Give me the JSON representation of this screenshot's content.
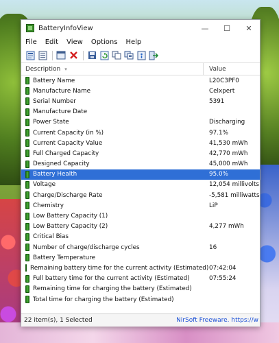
{
  "window": {
    "title": "BatteryInfoView",
    "minimize": "—",
    "maximize": "☐",
    "close": "✕"
  },
  "menu": [
    "File",
    "Edit",
    "View",
    "Options",
    "Help"
  ],
  "toolbar_icons": [
    "html-report-icon",
    "text-report-icon",
    "properties-icon",
    "delete-icon",
    "save-icon",
    "refresh-icon",
    "copy-icon",
    "copy-all-icon",
    "about-icon",
    "exit-icon"
  ],
  "list": {
    "header_description": "Description",
    "header_value": "Value",
    "rows": [
      {
        "label": "Battery Name",
        "value": "L20C3PF0"
      },
      {
        "label": "Manufacture Name",
        "value": "Celxpert"
      },
      {
        "label": "Serial Number",
        "value": " 5391"
      },
      {
        "label": "Manufacture Date",
        "value": ""
      },
      {
        "label": "Power State",
        "value": "Discharging"
      },
      {
        "label": "Current Capacity (in %)",
        "value": "97.1%"
      },
      {
        "label": "Current Capacity Value",
        "value": "41,530 mWh"
      },
      {
        "label": "Full Charged Capacity",
        "value": "42,770 mWh"
      },
      {
        "label": "Designed Capacity",
        "value": "45,000 mWh"
      },
      {
        "label": "Battery Health",
        "value": "95.0%"
      },
      {
        "label": "Voltage",
        "value": "12,054 millivolts"
      },
      {
        "label": "Charge/Discharge Rate",
        "value": "-5,581 milliwatts"
      },
      {
        "label": "Chemistry",
        "value": "LiP"
      },
      {
        "label": "Low Battery Capacity (1)",
        "value": ""
      },
      {
        "label": "Low Battery Capacity (2)",
        "value": "4,277 mWh"
      },
      {
        "label": "Critical Bias",
        "value": ""
      },
      {
        "label": "Number of charge/discharge cycles",
        "value": "16"
      },
      {
        "label": "Battery Temperature",
        "value": ""
      },
      {
        "label": "Remaining battery time for the current activity (Estimated)",
        "value": "07:42:04"
      },
      {
        "label": "Full battery time for the current activity (Estimated)",
        "value": "07:55:24"
      },
      {
        "label": "Remaining time for charging the battery (Estimated)",
        "value": ""
      },
      {
        "label": "Total  time for charging the battery (Estimated)",
        "value": ""
      }
    ],
    "selected_index": 9
  },
  "status": {
    "left": "22 item(s), 1 Selected",
    "right": "NirSoft Freeware.  https://w"
  },
  "colors": {
    "selection": "#2f6fd6",
    "link": "#1a4fd6"
  }
}
